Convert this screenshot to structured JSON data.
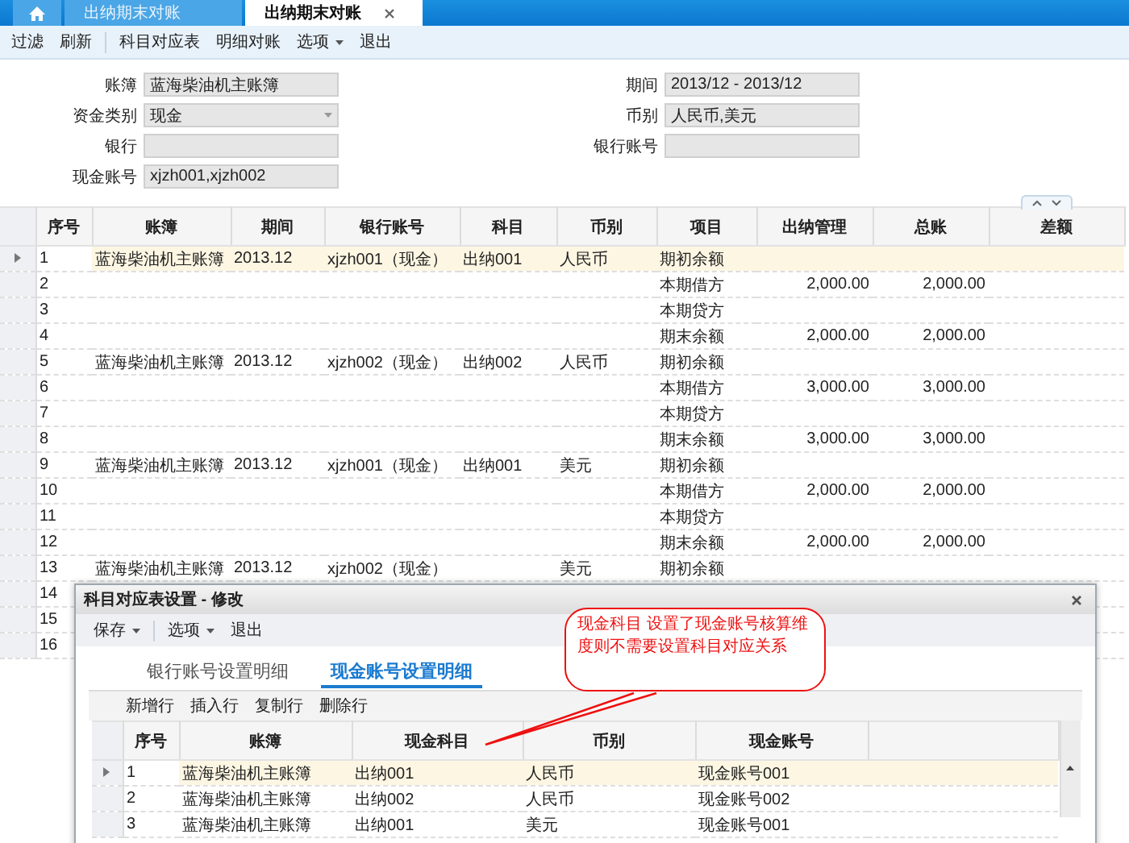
{
  "tabs": [
    {
      "kind": "home",
      "selected": false
    },
    {
      "kind": "text",
      "label": "出纳期末对账",
      "selected": false
    },
    {
      "kind": "text",
      "label": "出纳期末对账",
      "selected": true
    }
  ],
  "toolbar": [
    [
      {
        "label": "过滤",
        "dropdown": false
      },
      {
        "label": "刷新",
        "dropdown": false
      }
    ],
    [
      {
        "label": "科目对应表",
        "dropdown": false
      },
      {
        "label": "明细对账",
        "dropdown": false
      },
      {
        "label": "选项",
        "dropdown": true
      },
      {
        "label": "退出",
        "dropdown": false
      }
    ]
  ],
  "form": {
    "left": [
      {
        "label": "账簿",
        "value": "蓝海柴油机主账簿",
        "kind": "text"
      },
      {
        "label": "资金类别",
        "value": "现金",
        "kind": "select"
      },
      {
        "label": "银行",
        "kind": "text"
      },
      {
        "label": "现金账号",
        "value": "xjzh001,xjzh002",
        "kind": "text"
      }
    ],
    "right": [
      {
        "label": "期间",
        "value": "2013/12 - 2013/12"
      },
      {
        "label": "币别",
        "value": "人民币,美元"
      },
      {
        "label": "银行账号"
      }
    ]
  },
  "grid": {
    "columns": [
      "序号",
      "账簿",
      "期间",
      "银行账号",
      "科目",
      "币别",
      "项目",
      "出纳管理",
      "总账",
      "差额"
    ],
    "rows": [
      {
        "selected": true,
        "seq": "1",
        "book": "蓝海柴油机主账簿",
        "period": "2013.12",
        "bank_account": "xjzh001（现金）",
        "subject": "出纳001",
        "currency": "人民币",
        "item": "期初余额"
      },
      {
        "selected": false,
        "seq": "2",
        "item": "本期借方",
        "cashier": "2,000.00",
        "ledger": "2,000.00"
      },
      {
        "selected": false,
        "seq": "3",
        "item": "本期贷方"
      },
      {
        "selected": false,
        "seq": "4",
        "item": "期末余额",
        "cashier": "2,000.00",
        "ledger": "2,000.00"
      },
      {
        "selected": false,
        "seq": "5",
        "book": "蓝海柴油机主账簿",
        "period": "2013.12",
        "bank_account": "xjzh002（现金）",
        "subject": "出纳002",
        "currency": "人民币",
        "item": "期初余额"
      },
      {
        "selected": false,
        "seq": "6",
        "item": "本期借方",
        "cashier": "3,000.00",
        "ledger": "3,000.00"
      },
      {
        "selected": false,
        "seq": "7",
        "item": "本期贷方"
      },
      {
        "selected": false,
        "seq": "8",
        "item": "期末余额",
        "cashier": "3,000.00",
        "ledger": "3,000.00"
      },
      {
        "selected": false,
        "seq": "9",
        "book": "蓝海柴油机主账簿",
        "period": "2013.12",
        "bank_account": "xjzh001（现金）",
        "subject": "出纳001",
        "currency": "美元",
        "item": "期初余额"
      },
      {
        "selected": false,
        "seq": "10",
        "item": "本期借方",
        "cashier": "2,000.00",
        "ledger": "2,000.00"
      },
      {
        "selected": false,
        "seq": "11",
        "item": "本期贷方"
      },
      {
        "selected": false,
        "seq": "12",
        "item": "期末余额",
        "cashier": "2,000.00",
        "ledger": "2,000.00"
      },
      {
        "selected": false,
        "seq": "13",
        "book": "蓝海柴油机主账簿",
        "period": "2013.12",
        "bank_account": "xjzh002（现金）",
        "currency": "美元",
        "item": "期初余额"
      },
      {
        "selected": false,
        "seq": "14"
      },
      {
        "selected": false,
        "seq": "15"
      },
      {
        "selected": false,
        "seq": "16"
      }
    ]
  },
  "dialog": {
    "title": "科目对应表设置 - 修改",
    "toolbar": [
      [
        {
          "label": "保存",
          "dropdown": true
        }
      ],
      [
        {
          "label": "选项",
          "dropdown": true
        },
        {
          "label": "退出",
          "dropdown": false
        }
      ]
    ],
    "tabs": [
      {
        "label": "银行账号设置明细",
        "selected": false
      },
      {
        "label": "现金账号设置明细",
        "selected": true
      }
    ],
    "row_actions": [
      "新增行",
      "插入行",
      "复制行",
      "删除行"
    ],
    "grid": {
      "columns": [
        "序号",
        "账簿",
        "现金科目",
        "币别",
        "现金账号"
      ],
      "rows": [
        {
          "selected": true,
          "seq": "1",
          "book": "蓝海柴油机主账簿",
          "cash_subject": "出纳001",
          "currency": "人民币",
          "cash_account": "现金账号001"
        },
        {
          "selected": false,
          "seq": "2",
          "book": "蓝海柴油机主账簿",
          "cash_subject": "出纳002",
          "currency": "人民币",
          "cash_account": "现金账号002"
        },
        {
          "selected": false,
          "seq": "3",
          "book": "蓝海柴油机主账簿",
          "cash_subject": "出纳001",
          "currency": "美元",
          "cash_account": "现金账号001"
        }
      ]
    }
  },
  "callout": {
    "text": "现金科目 设置了现金账号核算维度则不需要设置科目对应关系"
  }
}
